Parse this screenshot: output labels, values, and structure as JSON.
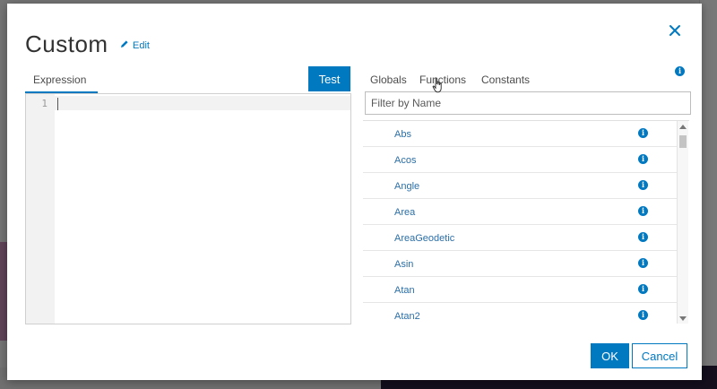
{
  "dialog": {
    "title": "Custom",
    "edit_label": "Edit"
  },
  "tabs": {
    "expression": "Expression",
    "globals": "Globals",
    "functions": "Functions",
    "constants": "Constants",
    "active_left": "Expression",
    "active_right": "Functions"
  },
  "editor": {
    "test_label": "Test",
    "line_number": "1",
    "content": ""
  },
  "filter": {
    "placeholder": "Filter by Name",
    "value": ""
  },
  "functions": [
    "Abs",
    "Acos",
    "Angle",
    "Area",
    "AreaGeodetic",
    "Asin",
    "Atan",
    "Atan2"
  ],
  "buttons": {
    "ok": "OK",
    "cancel": "Cancel"
  },
  "icons": {
    "close": "close-icon",
    "edit": "pencil-icon",
    "info": "info-icon"
  },
  "colors": {
    "accent": "#0079c1",
    "function_text": "#2b6fa8"
  }
}
